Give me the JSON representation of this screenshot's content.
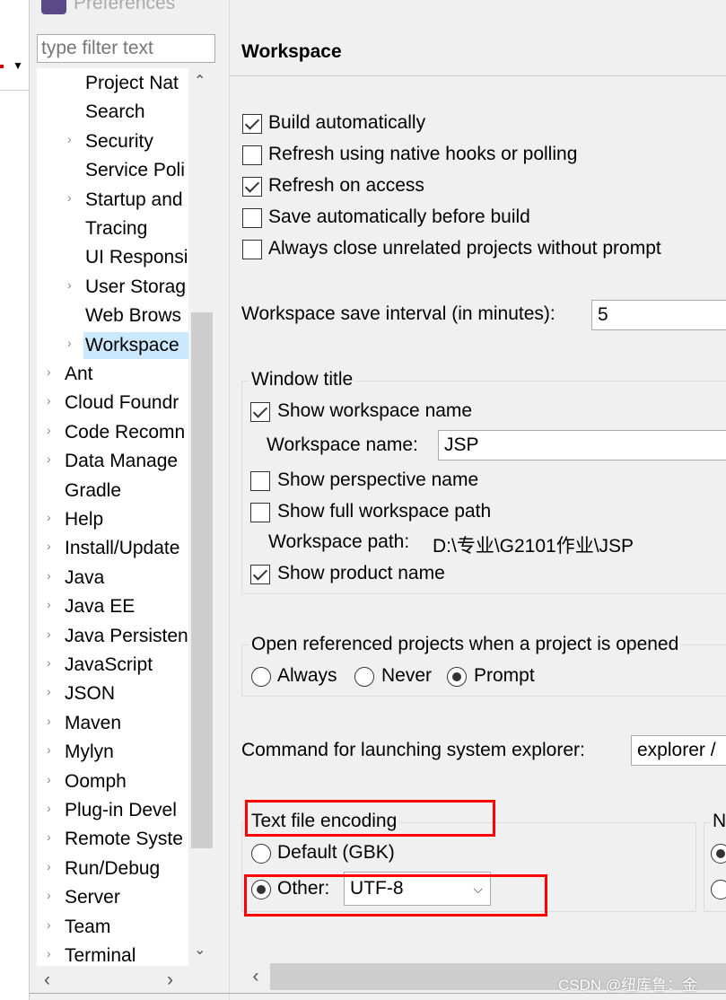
{
  "dialog": {
    "title": "Preferences"
  },
  "filter": {
    "placeholder": "type filter text"
  },
  "tree": {
    "items": [
      {
        "label": "Project Nat",
        "level": 1,
        "expandable": false
      },
      {
        "label": "Search",
        "level": 1,
        "expandable": false
      },
      {
        "label": "Security",
        "level": 1,
        "expandable": true
      },
      {
        "label": "Service Poli",
        "level": 1,
        "expandable": false
      },
      {
        "label": "Startup and",
        "level": 1,
        "expandable": true
      },
      {
        "label": "Tracing",
        "level": 1,
        "expandable": false
      },
      {
        "label": "UI Responsi",
        "level": 1,
        "expandable": false
      },
      {
        "label": "User Storag",
        "level": 1,
        "expandable": true
      },
      {
        "label": "Web Brows",
        "level": 1,
        "expandable": false
      },
      {
        "label": "Workspace",
        "level": 1,
        "expandable": true,
        "selected": true
      },
      {
        "label": "Ant",
        "level": 0,
        "expandable": true
      },
      {
        "label": "Cloud Foundr",
        "level": 0,
        "expandable": true
      },
      {
        "label": "Code Recomn",
        "level": 0,
        "expandable": true
      },
      {
        "label": "Data Manage",
        "level": 0,
        "expandable": true
      },
      {
        "label": "Gradle",
        "level": 0,
        "expandable": false
      },
      {
        "label": "Help",
        "level": 0,
        "expandable": true
      },
      {
        "label": "Install/Update",
        "level": 0,
        "expandable": true
      },
      {
        "label": "Java",
        "level": 0,
        "expandable": true
      },
      {
        "label": "Java EE",
        "level": 0,
        "expandable": true
      },
      {
        "label": "Java Persisten",
        "level": 0,
        "expandable": true
      },
      {
        "label": "JavaScript",
        "level": 0,
        "expandable": true
      },
      {
        "label": "JSON",
        "level": 0,
        "expandable": true
      },
      {
        "label": "Maven",
        "level": 0,
        "expandable": true
      },
      {
        "label": "Mylyn",
        "level": 0,
        "expandable": true
      },
      {
        "label": "Oomph",
        "level": 0,
        "expandable": true
      },
      {
        "label": "Plug-in Devel",
        "level": 0,
        "expandable": true
      },
      {
        "label": "Remote Syste",
        "level": 0,
        "expandable": true
      },
      {
        "label": "Run/Debug",
        "level": 0,
        "expandable": true
      },
      {
        "label": "Server",
        "level": 0,
        "expandable": true
      },
      {
        "label": "Team",
        "level": 0,
        "expandable": true
      },
      {
        "label": "Terminal",
        "level": 0,
        "expandable": true
      }
    ]
  },
  "page": {
    "title": "Workspace",
    "checkboxes": [
      {
        "label": "Build automatically",
        "checked": true
      },
      {
        "label": "Refresh using native hooks or polling",
        "checked": false
      },
      {
        "label": "Refresh on access",
        "checked": true
      },
      {
        "label": "Save automatically before build",
        "checked": false
      },
      {
        "label": "Always close unrelated projects without prompt",
        "checked": false
      }
    ],
    "save_interval": {
      "label": "Workspace save interval (in minutes):",
      "value": "5"
    },
    "window_title": {
      "legend": "Window title",
      "show_workspace_name": {
        "label": "Show workspace name",
        "checked": true
      },
      "workspace_name": {
        "label": "Workspace name:",
        "value": "JSP"
      },
      "show_perspective_name": {
        "label": "Show perspective name",
        "checked": false
      },
      "show_full_path": {
        "label": "Show full workspace path",
        "checked": false
      },
      "workspace_path": {
        "label": "Workspace path:",
        "value": "D:\\专业\\G2101作业\\JSP"
      },
      "show_product_name": {
        "label": "Show product name",
        "checked": true
      }
    },
    "open_referenced": {
      "legend": "Open referenced projects when a project is opened",
      "options": [
        "Always",
        "Never",
        "Prompt"
      ],
      "selected": "Prompt"
    },
    "system_explorer": {
      "label": "Command for launching system explorer:",
      "value": "explorer /"
    },
    "encoding": {
      "legend": "Text file encoding",
      "default_label": "Default (GBK)",
      "other_label": "Other:",
      "selected": "Other",
      "other_value": "UTF-8"
    },
    "line_delimiter": {
      "legend": "N"
    }
  },
  "watermark": "CSDN @纽库鲁：金",
  "colors": {
    "highlight": "#ff0000",
    "selection": "#cce8ff"
  }
}
